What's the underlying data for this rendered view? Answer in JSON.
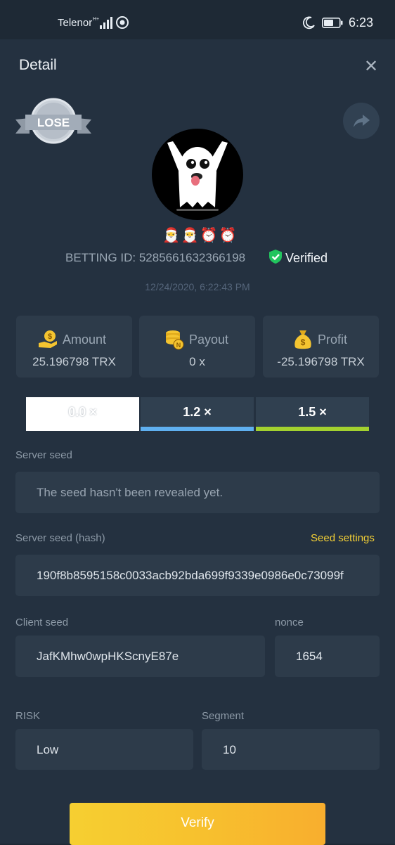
{
  "status_bar": {
    "carrier": "Telenor",
    "time": "6:23"
  },
  "header": {
    "title": "Detail",
    "close_glyph": "✕"
  },
  "result_badge": "LOSE",
  "badges_emoji": "🎅🎅⏰⏰",
  "betting_id": "BETTING ID: 5285661632366198",
  "verified_label": "Verified",
  "timestamp": "12/24/2020, 6:22:43 PM",
  "stats": {
    "amount": {
      "label": "Amount",
      "value": "25.196798 TRX",
      "icon": "coin-hand-icon"
    },
    "payout": {
      "label": "Payout",
      "value": "0 x",
      "icon": "coin-stack-icon"
    },
    "profit": {
      "label": "Profit",
      "value": "-25.196798 TRX",
      "icon": "money-bag-icon"
    }
  },
  "multiplier_tabs": [
    {
      "label": "0.0 ×",
      "color": "#ffffff",
      "active": true
    },
    {
      "label": "1.2 ×",
      "color": "#5fb0f0",
      "active": false
    },
    {
      "label": "1.5 ×",
      "color": "#a3d12f",
      "active": false
    }
  ],
  "server_seed": {
    "label": "Server seed",
    "value": "The seed hasn't been revealed yet."
  },
  "server_seed_hash": {
    "label": "Server seed (hash)",
    "link": "Seed settings",
    "value": "190f8b8595158c0033acb92bda699f9339e0986e0c73099f"
  },
  "client_seed": {
    "label": "Client seed",
    "value": "JafKMhw0wpHKScnyE87e"
  },
  "nonce": {
    "label": "nonce",
    "value": "1654"
  },
  "risk": {
    "label": "RISK",
    "value": "Low"
  },
  "segment": {
    "label": "Segment",
    "value": "10"
  },
  "verify_button": "Verify",
  "colors": {
    "background": "#243140",
    "card": "#2d3b4a",
    "accent_yellow": "#f6c52f",
    "verified_green": "#22c55e"
  }
}
